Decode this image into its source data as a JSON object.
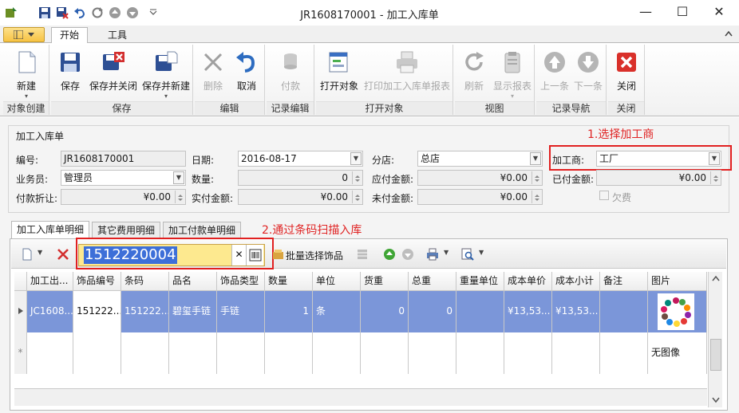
{
  "window": {
    "title": "JR1608170001 - 加工入库单",
    "controls": {
      "minimize": "—",
      "maximize": "☐",
      "close": "✕"
    }
  },
  "tabs": {
    "home": "开始",
    "tools": "工具"
  },
  "ribbon": {
    "groups": {
      "create": "对象创建",
      "save": "保存",
      "edit": "编辑",
      "record_edit": "记录编辑",
      "open_object": "打开对象",
      "view": "视图",
      "record_nav": "记录导航",
      "close": "关闭"
    },
    "buttons": {
      "new": "新建",
      "save": "保存",
      "save_close": "保存并关闭",
      "save_new": "保存并新建",
      "delete": "删除",
      "cancel": "取消",
      "pay": "付款",
      "open_object": "打开对象",
      "print_report": "打印加工入库单报表",
      "refresh": "刷新",
      "show_report": "显示报表",
      "prev": "上一条",
      "next": "下一条",
      "close": "关闭"
    }
  },
  "form": {
    "section_title": "加工入库单",
    "number_label": "编号:",
    "number_value": "JR1608170001",
    "date_label": "日期:",
    "date_value": "2016-08-17",
    "branch_label": "分店:",
    "branch_value": "总店",
    "processor_label": "加工商:",
    "processor_value": "工厂",
    "salesman_label": "业务员:",
    "salesman_value": "管理员",
    "quantity_label": "数量:",
    "quantity_value": "0",
    "payable_label": "应付金额:",
    "payable_value": "¥0.00",
    "paid_label": "已付金额:",
    "paid_value": "¥0.00",
    "discount_label": "付款折让:",
    "discount_value": "¥0.00",
    "actual_label": "实付金额:",
    "actual_value": "¥0.00",
    "unpaid_label": "未付金额:",
    "unpaid_value": "¥0.00",
    "owed_label": "欠费"
  },
  "annotations": {
    "step1": "1.选择加工商",
    "step2": "2.通过条码扫描入库"
  },
  "detail_tabs": {
    "items": "加工入库单明细",
    "other_fees": "其它费用明细",
    "payments": "加工付款单明细"
  },
  "toolbar": {
    "barcode_value": "1512220004",
    "batch_select": "批量选择饰品"
  },
  "grid": {
    "columns": [
      "加工出...",
      "饰品编号",
      "条码",
      "品名",
      "饰品类型",
      "数量",
      "单位",
      "货重",
      "总重",
      "重量单位",
      "成本单价",
      "成本小计",
      "备注",
      "图片"
    ],
    "row": {
      "order": "JC1608...",
      "item_code": "151222...",
      "barcode": "151222...",
      "name": "碧玺手链",
      "type": "手链",
      "qty": "1",
      "unit": "条",
      "net_weight": "0",
      "gross_weight": "0",
      "weight_unit": "",
      "unit_cost": "¥13,53...",
      "cost_subtotal": "¥13,53...",
      "remark": ""
    },
    "no_image": "无图像"
  }
}
